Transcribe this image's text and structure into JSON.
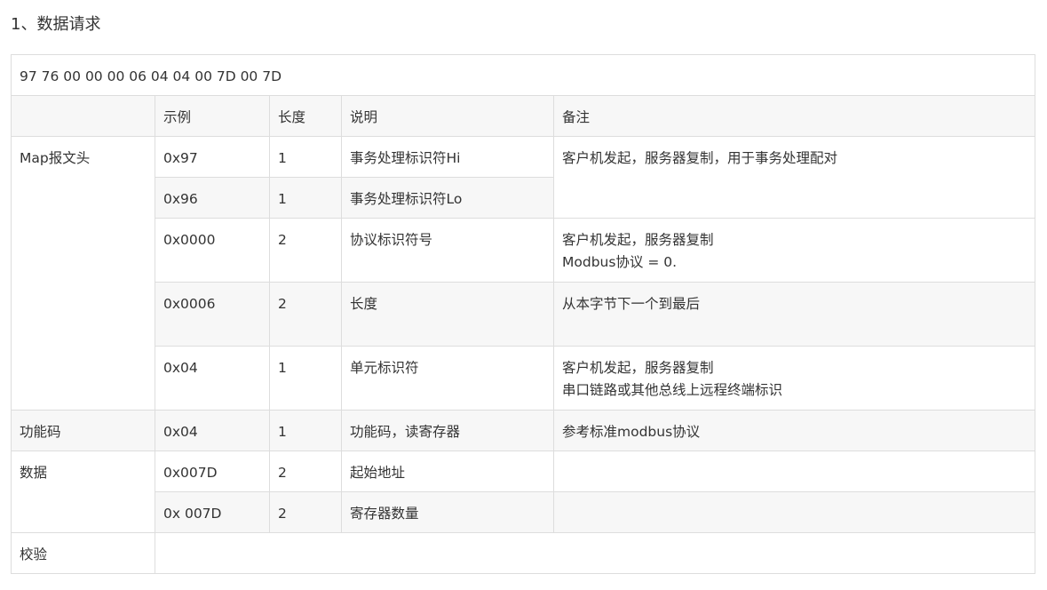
{
  "heading": "1、数据请求",
  "table": {
    "hex_line": "97 76 00 00 00 06 04 04 00 7D 00 7D",
    "headers": [
      "",
      "示例",
      "长度",
      "说明",
      "备注"
    ],
    "groups": {
      "map_header": "Map报文头",
      "func_code": "功能码",
      "data": "数据",
      "checksum": "校验"
    },
    "rows": [
      {
        "example": "0x97",
        "length": "1",
        "desc": "事务处理标识符Hi",
        "note": [
          "客户机发起，服务器复制，用于事务处理配对"
        ]
      },
      {
        "example": "0x96",
        "length": "1",
        "desc": "事务处理标识符Lo"
      },
      {
        "example": "0x0000",
        "length": "2",
        "desc": "协议标识符号",
        "note": [
          "客户机发起，服务器复制",
          "Modbus协议 = 0."
        ]
      },
      {
        "example": "0x0006",
        "length": "2",
        "desc": "长度",
        "note": [
          "从本字节下一个到最后"
        ]
      },
      {
        "example": "0x04",
        "length": "1",
        "desc": "单元标识符",
        "note": [
          "客户机发起，服务器复制",
          "串口链路或其他总线上远程终端标识"
        ]
      },
      {
        "example": "0x04",
        "length": "1",
        "desc": "功能码，读寄存器",
        "note": [
          "参考标准modbus协议"
        ]
      },
      {
        "example": "0x007D",
        "length": "2",
        "desc": "起始地址",
        "note": [
          ""
        ]
      },
      {
        "example": "0x 007D",
        "length": "2",
        "desc": "寄存器数量",
        "note": [
          ""
        ]
      }
    ]
  }
}
